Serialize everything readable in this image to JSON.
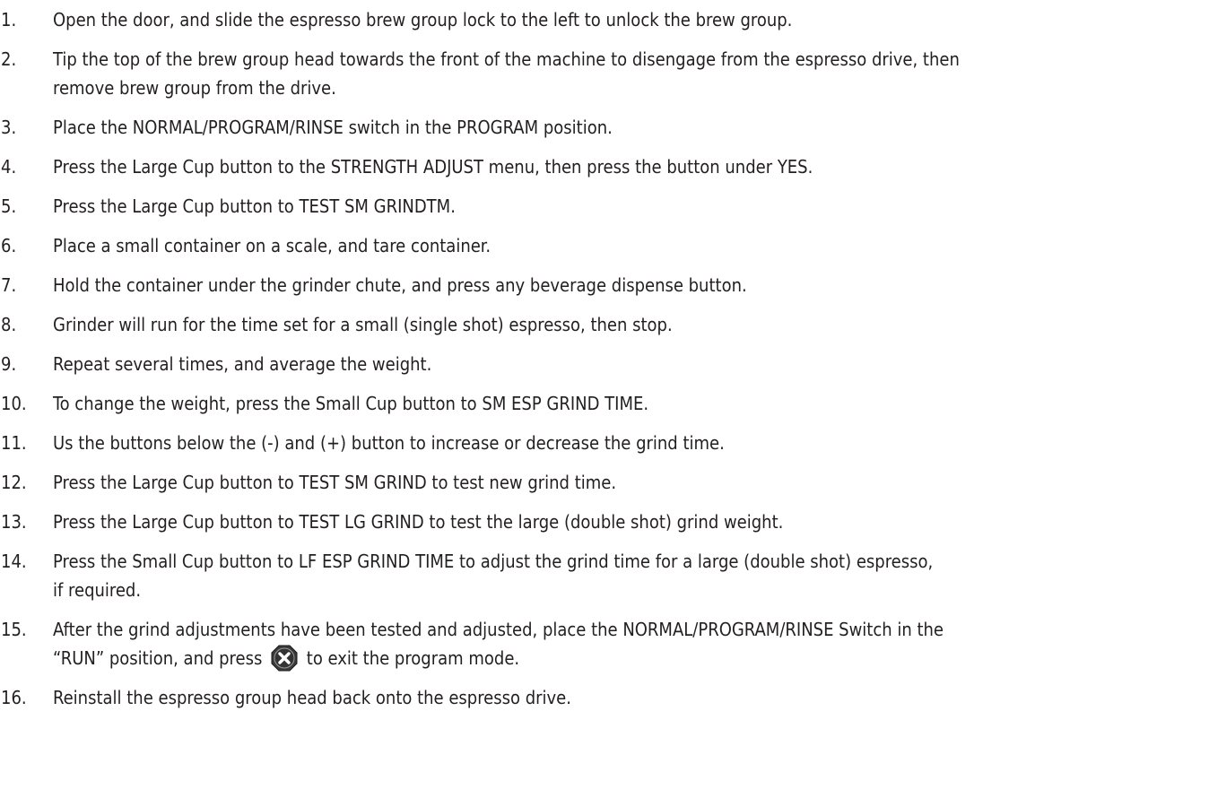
{
  "steps": [
    {
      "num": "1.",
      "lines": [
        "Open the door, and slide the espresso brew group lock to the left to unlock the brew group."
      ]
    },
    {
      "num": "2.",
      "lines": [
        "Tip the top of the brew group head towards the front of the machine to disengage from the espresso drive, then",
        "remove brew group from the drive."
      ]
    },
    {
      "num": "3.",
      "lines": [
        "Place the NORMAL/PROGRAM/RINSE switch in the PROGRAM position."
      ]
    },
    {
      "num": "4.",
      "lines": [
        "Press the Large Cup button to the STRENGTH ADJUST menu, then press the button under YES."
      ]
    },
    {
      "num": "5.",
      "lines": [
        "Press the Large Cup button to TEST SM GRINDTM."
      ]
    },
    {
      "num": "6.",
      "lines": [
        "Place a small container on a scale, and tare container."
      ]
    },
    {
      "num": "7.",
      "lines": [
        "Hold the container under the grinder chute, and press any beverage dispense button."
      ]
    },
    {
      "num": "8.",
      "lines": [
        "Grinder will run for the time set for a small (single shot) espresso, then stop."
      ]
    },
    {
      "num": "9.",
      "lines": [
        "Repeat several times, and average the weight."
      ]
    },
    {
      "num": "10.",
      "lines": [
        "To change the weight, press the Small Cup button to SM ESP GRIND TIME."
      ]
    },
    {
      "num": "11.",
      "lines": [
        "Us the buttons below the (-) and (+) button to increase or decrease the grind time."
      ]
    },
    {
      "num": "12.",
      "lines": [
        "Press the Large Cup button to TEST SM GRIND to test new grind time."
      ]
    },
    {
      "num": "13.",
      "lines": [
        "Press the Large Cup button to TEST LG GRIND to test the large (double shot) grind weight."
      ]
    },
    {
      "num": "14.",
      "lines": [
        "Press the Small Cup button to LF ESP GRIND TIME to adjust the grind time for a large (double shot) espresso,",
        "if required."
      ]
    }
  ],
  "step15": {
    "num": "15.",
    "line1": "After the grind adjustments have been tested and adjusted, place the NORMAL/PROGRAM/RINSE Switch in the",
    "line2_before": "“RUN” position, and press",
    "line2_icon": "exit-x-icon",
    "line2_after": "to exit the program mode."
  },
  "step16": {
    "num": "16.",
    "text": "Reinstall the espresso group head back onto the espresso drive."
  },
  "colors": {
    "text": "#231f20",
    "icon_fill": "#3a3a3a",
    "icon_x": "#ffffff"
  }
}
